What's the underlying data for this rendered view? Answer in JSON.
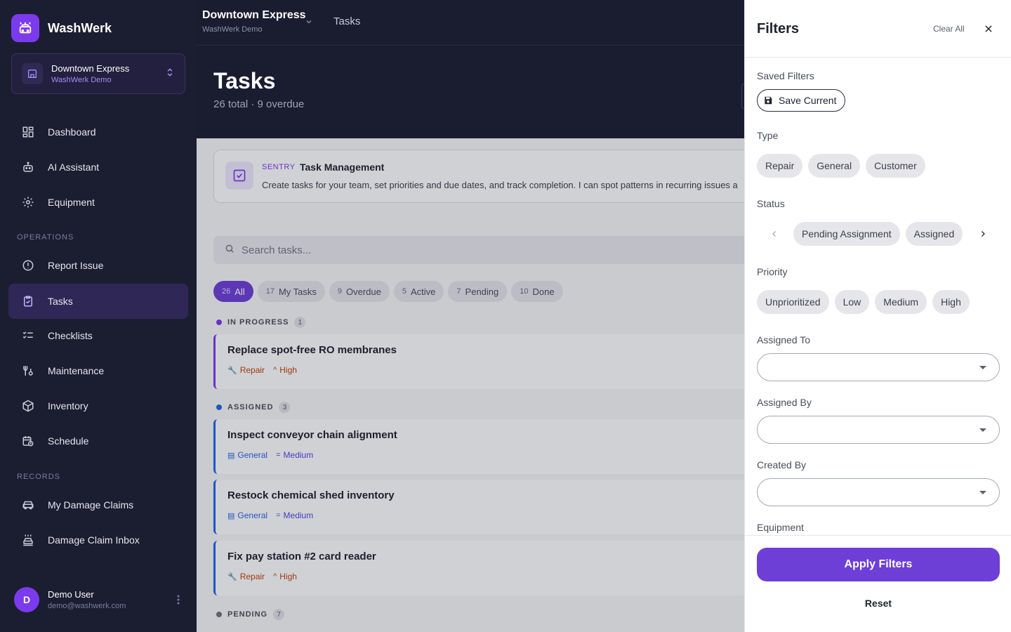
{
  "app": {
    "name": "WashWerk"
  },
  "org": {
    "name": "Downtown Express",
    "sub": "WashWerk Demo"
  },
  "sidebar": {
    "items": [
      {
        "label": "Dashboard",
        "icon": "dashboard-icon"
      },
      {
        "label": "AI Assistant",
        "icon": "robot-icon"
      },
      {
        "label": "Equipment",
        "icon": "gear-icon"
      }
    ],
    "operations_label": "OPERATIONS",
    "operations": [
      {
        "label": "Report Issue",
        "icon": "alert-circle-icon"
      },
      {
        "label": "Tasks",
        "icon": "clipboard-check-icon"
      },
      {
        "label": "Checklists",
        "icon": "checklist-icon"
      },
      {
        "label": "Maintenance",
        "icon": "wrench-icon"
      },
      {
        "label": "Inventory",
        "icon": "box-icon"
      },
      {
        "label": "Schedule",
        "icon": "calendar-clock-icon"
      }
    ],
    "records_label": "RECORDS",
    "records": [
      {
        "label": "My Damage Claims",
        "icon": "car-icon"
      },
      {
        "label": "Damage Claim Inbox",
        "icon": "car-wash-icon"
      }
    ]
  },
  "user": {
    "initial": "D",
    "name": "Demo User",
    "email": "demo@washwerk.com"
  },
  "topbar": {
    "location": "Downtown Express",
    "location_sub": "WashWerk Demo",
    "crumb": "Tasks"
  },
  "page": {
    "title": "Tasks",
    "subtitle": "26 total · 9 overdue"
  },
  "sentry": {
    "tag": "SENTRY",
    "title": "Task Management",
    "description": "Create tasks for your team, set priorities and due dates, and track completion. I can spot patterns in recurring issues a"
  },
  "search": {
    "placeholder": "Search tasks..."
  },
  "tabs": [
    {
      "count": "26",
      "label": "All"
    },
    {
      "count": "17",
      "label": "My Tasks"
    },
    {
      "count": "9",
      "label": "Overdue"
    },
    {
      "count": "5",
      "label": "Active"
    },
    {
      "count": "7",
      "label": "Pending"
    },
    {
      "count": "10",
      "label": "Done"
    }
  ],
  "groups": {
    "in_progress": {
      "label": "IN PROGRESS",
      "count": "1",
      "color": "#7c3aed"
    },
    "assigned": {
      "label": "ASSIGNED",
      "count": "3",
      "color": "#2563eb"
    },
    "pending": {
      "label": "PENDING",
      "count": "7",
      "color": "#6b7280"
    }
  },
  "tasks": [
    {
      "title": "Replace spot-free RO membranes",
      "type": "Repair",
      "priority": "High"
    },
    {
      "title": "Inspect conveyor chain alignment",
      "type": "General",
      "priority": "Medium"
    },
    {
      "title": "Restock chemical shed inventory",
      "type": "General",
      "priority": "Medium"
    },
    {
      "title": "Fix pay station #2 card reader",
      "type": "Repair",
      "priority": "High"
    }
  ],
  "filters": {
    "title": "Filters",
    "clear_all": "Clear All",
    "saved_label": "Saved Filters",
    "save_current": "Save Current",
    "type_label": "Type",
    "types": [
      "Repair",
      "General",
      "Customer"
    ],
    "status_label": "Status",
    "statuses": [
      "Pending Assignment",
      "Assigned"
    ],
    "priority_label": "Priority",
    "priorities": [
      "Unprioritized",
      "Low",
      "Medium",
      "High"
    ],
    "assigned_to_label": "Assigned To",
    "assigned_by_label": "Assigned By",
    "created_by_label": "Created By",
    "equipment_label": "Equipment",
    "apply": "Apply Filters",
    "reset": "Reset"
  },
  "colors": {
    "accent": "#6d3fd6",
    "sidebar_bg": "#1b1e31",
    "repair": "#c2410c",
    "general": "#2563eb"
  }
}
